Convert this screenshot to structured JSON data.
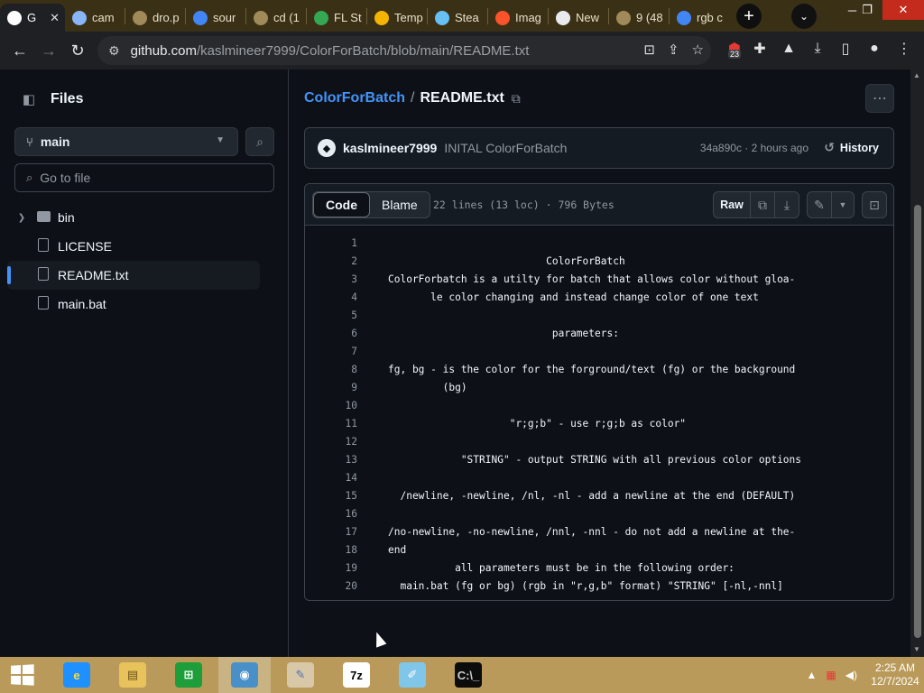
{
  "browser": {
    "tabs": [
      {
        "title": "G",
        "icon": "github-icon",
        "color": "#ffffff"
      },
      {
        "title": "cam",
        "icon": "globe-icon",
        "color": "#8ab4f8"
      },
      {
        "title": "dro.p",
        "icon": "folder-icon",
        "color": "#a08a5a"
      },
      {
        "title": "sour",
        "icon": "google-icon",
        "color": "#4285f4"
      },
      {
        "title": "cd (1",
        "icon": "folder-icon",
        "color": "#a08a5a"
      },
      {
        "title": "FL St",
        "icon": "play-store-icon",
        "color": "#34a853"
      },
      {
        "title": "Temp",
        "icon": "mail-icon",
        "color": "#f4b400"
      },
      {
        "title": "Stea",
        "icon": "steam-icon",
        "color": "#66c0f4"
      },
      {
        "title": "Imag",
        "icon": "brave-icon",
        "color": "#fb542b"
      },
      {
        "title": "New",
        "icon": "chrome-icon",
        "color": "#e8eaed"
      },
      {
        "title": "9 (48",
        "icon": "folder-icon",
        "color": "#a08a5a"
      },
      {
        "title": "rgb c",
        "icon": "google-icon",
        "color": "#4285f4"
      }
    ],
    "url_host": "github.com",
    "url_path": "/kaslmineer7999/ColorForBatch/blob/main/README.txt",
    "extension_badge": "23"
  },
  "sidebar": {
    "title": "Files",
    "branch": "main",
    "goto_placeholder": "Go to file",
    "tree": [
      {
        "name": "bin",
        "type": "folder"
      },
      {
        "name": "LICENSE",
        "type": "file"
      },
      {
        "name": "README.txt",
        "type": "file",
        "selected": true
      },
      {
        "name": "main.bat",
        "type": "file"
      }
    ]
  },
  "main": {
    "repo": "ColorForBatch",
    "separator": "/",
    "file": "README.txt",
    "commit": {
      "author": "kaslmineer7999",
      "message": "INITAL ColorForBatch",
      "meta": "34a890c · 2 hours ago",
      "history": "History"
    },
    "viewer": {
      "tab_code": "Code",
      "tab_blame": "Blame",
      "file_info": "22 lines (13 loc) · 796 Bytes",
      "raw": "Raw"
    },
    "lines": [
      "",
      "                          ColorForBatch",
      "ColorForbatch is a utilty for batch that allows color without gloa-",
      "       le color changing and instead change color of one text",
      "",
      "                           parameters:",
      "",
      "fg, bg - is the color for the forground/text (fg) or the background",
      "         (bg)",
      "",
      "                    \"r;g;b\" - use r;g;b as color\"",
      "",
      "            \"STRING\" - output STRING with all previous color options",
      "",
      "  /newline, -newline, /nl, -nl - add a newline at the end (DEFAULT)",
      "",
      "/no-newline, -no-newline, /nnl, -nnl - do not add a newline at the-",
      "end",
      "           all parameters must be in the following order:",
      "  main.bat (fg or bg) (rgb in \"r,g,b\" format) \"STRING\" [-nl,-nnl]"
    ]
  },
  "taskbar": {
    "items": [
      {
        "name": "internet-explorer",
        "glyph": "e",
        "bg": "#1e90ff",
        "fg": "#ffdd33"
      },
      {
        "name": "file-explorer",
        "glyph": "▤",
        "bg": "#e8c25a",
        "fg": "#6b5020"
      },
      {
        "name": "store",
        "glyph": "⊞",
        "bg": "#1e9e3a",
        "fg": "#ffffff"
      },
      {
        "name": "chrome",
        "glyph": "◉",
        "bg": "#4a90c8",
        "fg": "#ffffff",
        "active": true
      },
      {
        "name": "paint",
        "glyph": "✎",
        "bg": "#d8c8a8",
        "fg": "#5070b0"
      },
      {
        "name": "7zip",
        "glyph": "7z",
        "bg": "#ffffff",
        "fg": "#000000"
      },
      {
        "name": "notepad",
        "glyph": "✐",
        "bg": "#7fc6e8",
        "fg": "#ffffff"
      },
      {
        "name": "command-prompt",
        "glyph": "C:\\_",
        "bg": "#0c0c0c",
        "fg": "#cccccc"
      }
    ],
    "time": "2:25 AM",
    "date": "12/7/2024"
  }
}
